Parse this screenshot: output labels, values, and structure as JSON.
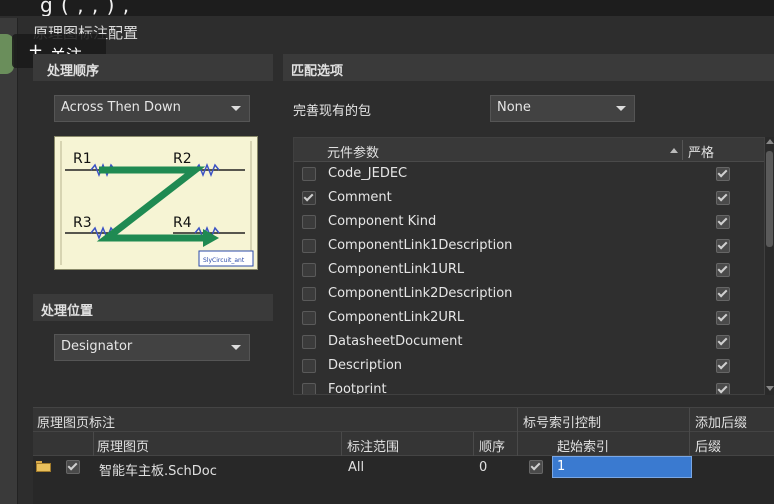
{
  "top_strip_text": "g          (   ,        ,              )             ,                    ",
  "dialog": {
    "title": "原理图标注配置"
  },
  "overlay": {
    "follow_plus": "+",
    "follow_label": "关注"
  },
  "order_section": {
    "title": "处理顺序",
    "dropdown_value": "Across Then Down",
    "diagram": {
      "labels": [
        "R1",
        "R2",
        "R3",
        "R4"
      ],
      "caption": "SlyCircuit_ant"
    }
  },
  "location_section": {
    "title": "处理位置",
    "dropdown_value": "Designator"
  },
  "match_section": {
    "title": "匹配选项",
    "complete_package_label": "完善现有的包",
    "complete_package_value": "None",
    "table": {
      "col_name": "元件参数",
      "col_strict": "严格",
      "rows": [
        {
          "name": "Code_JEDEC",
          "checked": false,
          "strict": true
        },
        {
          "name": "Comment",
          "checked": true,
          "strict": true
        },
        {
          "name": "Component Kind",
          "checked": false,
          "strict": true
        },
        {
          "name": "ComponentLink1Description",
          "checked": false,
          "strict": true
        },
        {
          "name": "ComponentLink1URL",
          "checked": false,
          "strict": true
        },
        {
          "name": "ComponentLink2Description",
          "checked": false,
          "strict": true
        },
        {
          "name": "ComponentLink2URL",
          "checked": false,
          "strict": true
        },
        {
          "name": "DatasheetDocument",
          "checked": false,
          "strict": true
        },
        {
          "name": "Description",
          "checked": false,
          "strict": true
        },
        {
          "name": "Footprint",
          "checked": false,
          "strict": true
        }
      ]
    }
  },
  "sheet_table": {
    "group_sheet": "原理图页标注",
    "group_index": "标号索引控制",
    "group_suffix": "添加后缀",
    "col_sheet": "原理图页",
    "col_scope": "标注范围",
    "col_order": "顺序",
    "col_start_index": "起始索引",
    "col_suffix": "后缀",
    "row": {
      "sheet": "智能车主板.SchDoc",
      "scope": "All",
      "order": "0",
      "start_index": "1",
      "suffix": ""
    }
  },
  "colors": {
    "accent_green": "#1f8a52",
    "selected_input": "#3a7ad0"
  }
}
